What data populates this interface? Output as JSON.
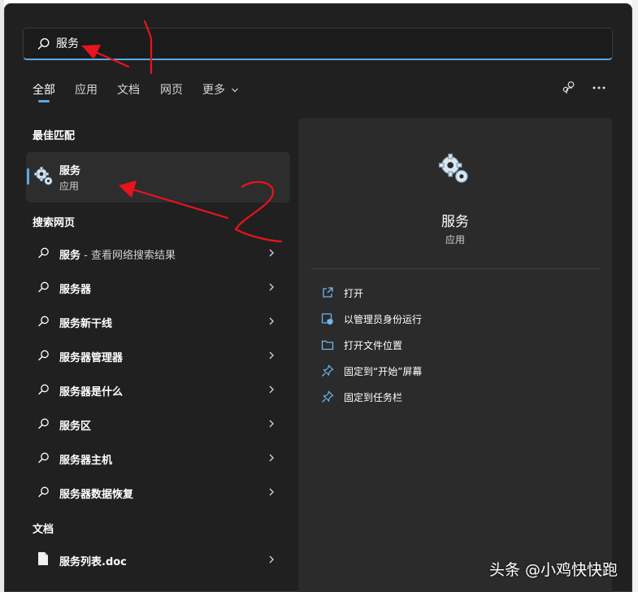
{
  "search": {
    "query": "服务"
  },
  "tabs": [
    "全部",
    "应用",
    "文档",
    "网页",
    "更多"
  ],
  "sections": {
    "best_match": "最佳匹配",
    "web": "搜索网页",
    "documents": "文档"
  },
  "best_match": {
    "name": "服务",
    "type": "应用"
  },
  "web_results": [
    {
      "bold": "服务",
      "suffix": " - 查看网络搜索结果"
    },
    {
      "bold": "服务器",
      "suffix": ""
    },
    {
      "bold": "服务新干线",
      "suffix": ""
    },
    {
      "bold": "服务器管理器",
      "suffix": ""
    },
    {
      "bold": "服务器是什么",
      "suffix": ""
    },
    {
      "bold": "服务区",
      "suffix": ""
    },
    {
      "bold": "服务器主机",
      "suffix": ""
    },
    {
      "bold": "服务器数据恢复",
      "suffix": ""
    }
  ],
  "document_results": [
    {
      "name": "服务列表.doc"
    }
  ],
  "detail": {
    "name": "服务",
    "type": "应用",
    "actions": [
      {
        "label": "打开",
        "icon": "open-external-icon"
      },
      {
        "label": "以管理员身份运行",
        "icon": "admin-shield-icon"
      },
      {
        "label": "打开文件位置",
        "icon": "folder-icon"
      },
      {
        "label": "固定到“开始”屏幕",
        "icon": "pin-icon"
      },
      {
        "label": "固定到任务栏",
        "icon": "pin-icon"
      }
    ]
  },
  "annotations": [
    "1",
    "2"
  ],
  "watermark": "头条 @小鸡快快跑",
  "colors": {
    "accent": "#5aa9e6",
    "panel": "#202020",
    "detail": "#2b2b2b",
    "annotation": "#e8141c"
  }
}
